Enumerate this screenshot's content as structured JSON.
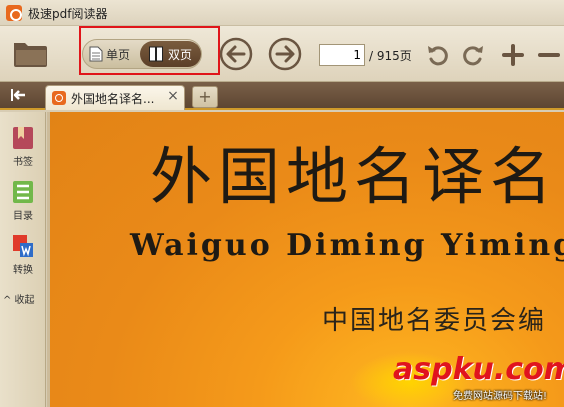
{
  "window": {
    "title": "极速pdf阅读器"
  },
  "toolbar": {
    "single_page_label": "单页",
    "double_page_label": "双页",
    "current_page": "1",
    "total_pages_label": "/ 915页"
  },
  "tabs": [
    {
      "label": "外国地名译名...",
      "close": "×"
    }
  ],
  "new_tab_label": "+",
  "sidebar": {
    "items": [
      {
        "label": "书签",
        "icon": "bookmark-icon"
      },
      {
        "label": "目录",
        "icon": "toc-icon"
      },
      {
        "label": "转换",
        "icon": "pdf-to-word-icon"
      }
    ],
    "collapse_label": "^ 收起"
  },
  "document": {
    "title_cn": "外国地名译名",
    "title_en": "Waiguo Diming Yiming",
    "author": "中国地名委员会编"
  },
  "watermark": {
    "main": "aspku.com",
    "sub": "免费网站源码下载站!"
  },
  "colors": {
    "accent_orange": "#e8691e",
    "highlight_red": "#e0151a",
    "page_orange": "#ea8a18",
    "watermark_red": "#e0141e"
  }
}
